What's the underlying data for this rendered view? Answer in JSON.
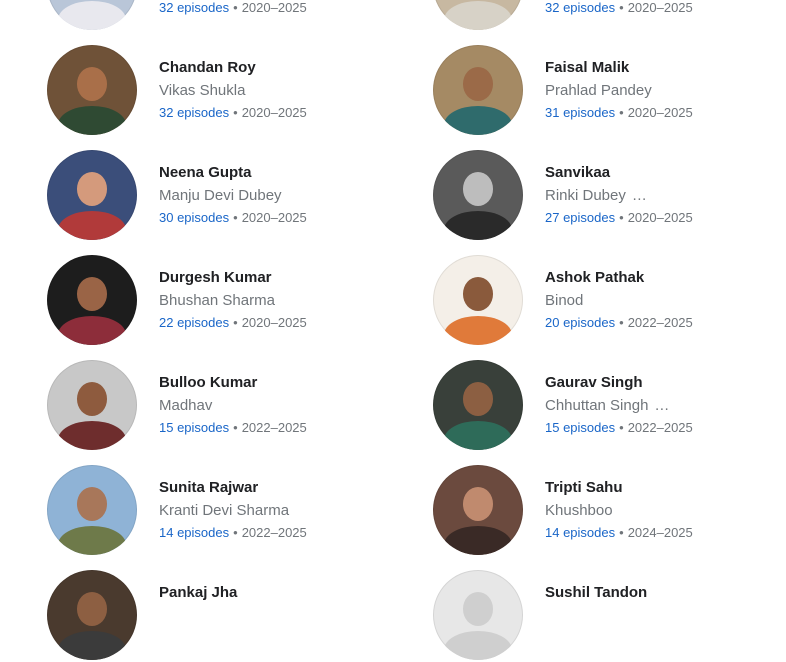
{
  "separator": "•",
  "cast": [
    {
      "name": "",
      "role": "",
      "episodes": "32 episodes",
      "years": "2020–2025",
      "ellipsis": "",
      "avatar": {
        "bg": "#b9c6d8",
        "skin": "#c99b7a",
        "cloth": "#e8e8ee"
      }
    },
    {
      "name": "",
      "role": "",
      "episodes": "32 episodes",
      "years": "2020–2025",
      "ellipsis": "",
      "avatar": {
        "bg": "#c7b8a1",
        "skin": "#b9805f",
        "cloth": "#d7d2c7"
      }
    },
    {
      "name": "Chandan Roy",
      "role": "Vikas Shukla",
      "episodes": "32 episodes",
      "years": "2020–2025",
      "ellipsis": "",
      "avatar": {
        "bg": "#6f5238",
        "skin": "#a96f49",
        "cloth": "#2f4a33"
      }
    },
    {
      "name": "Faisal Malik",
      "role": "Prahlad Pandey",
      "episodes": "31 episodes",
      "years": "2020–2025",
      "ellipsis": "",
      "avatar": {
        "bg": "#a58a64",
        "skin": "#9b6a48",
        "cloth": "#2f6b6c"
      }
    },
    {
      "name": "Neena Gupta",
      "role": "Manju Devi Dubey",
      "episodes": "30 episodes",
      "years": "2020–2025",
      "ellipsis": "",
      "avatar": {
        "bg": "#3b4e7a",
        "skin": "#d49a7c",
        "cloth": "#b13a3a"
      }
    },
    {
      "name": "Sanvikaa",
      "role": "Rinki Dubey",
      "episodes": "27 episodes",
      "years": "2020–2025",
      "ellipsis": "…",
      "avatar": {
        "bg": "#5a5a5a",
        "skin": "#bdbdbd",
        "cloth": "#2a2a2a"
      }
    },
    {
      "name": "Durgesh Kumar",
      "role": "Bhushan Sharma",
      "episodes": "22 episodes",
      "years": "2020–2025",
      "ellipsis": "",
      "avatar": {
        "bg": "#1d1d1d",
        "skin": "#9a6446",
        "cloth": "#8d2d3a"
      }
    },
    {
      "name": "Ashok Pathak",
      "role": "Binod",
      "episodes": "20 episodes",
      "years": "2022–2025",
      "ellipsis": "",
      "avatar": {
        "bg": "#f4efe8",
        "skin": "#8a5a3c",
        "cloth": "#e07a3a"
      }
    },
    {
      "name": "Bulloo Kumar",
      "role": "Madhav",
      "episodes": "15 episodes",
      "years": "2022–2025",
      "ellipsis": "",
      "avatar": {
        "bg": "#c8c8c8",
        "skin": "#8e5b3e",
        "cloth": "#6e2d2d"
      }
    },
    {
      "name": "Gaurav Singh",
      "role": "Chhuttan Singh",
      "episodes": "15 episodes",
      "years": "2022–2025",
      "ellipsis": "…",
      "avatar": {
        "bg": "#39403a",
        "skin": "#8c5f42",
        "cloth": "#2e6b59"
      }
    },
    {
      "name": "Sunita Rajwar",
      "role": "Kranti Devi Sharma",
      "episodes": "14 episodes",
      "years": "2022–2025",
      "ellipsis": "",
      "avatar": {
        "bg": "#8fb3d6",
        "skin": "#a8775a",
        "cloth": "#6e7a4a"
      }
    },
    {
      "name": "Tripti Sahu",
      "role": "Khushboo",
      "episodes": "14 episodes",
      "years": "2024–2025",
      "ellipsis": "",
      "avatar": {
        "bg": "#6b4a3e",
        "skin": "#c08a6e",
        "cloth": "#3a2a26"
      }
    },
    {
      "name": "Pankaj Jha",
      "role": "",
      "episodes": "",
      "years": "",
      "ellipsis": "",
      "avatar": {
        "bg": "#4a3a2e",
        "skin": "#8d5f42",
        "cloth": "#3b3b3b"
      }
    },
    {
      "name": "Sushil Tandon",
      "role": "",
      "episodes": "",
      "years": "",
      "ellipsis": "",
      "avatar": {
        "placeholder": true,
        "bg": "#e7e7e7",
        "skin": "#cfcfcf",
        "cloth": "#cfcfcf"
      }
    }
  ]
}
